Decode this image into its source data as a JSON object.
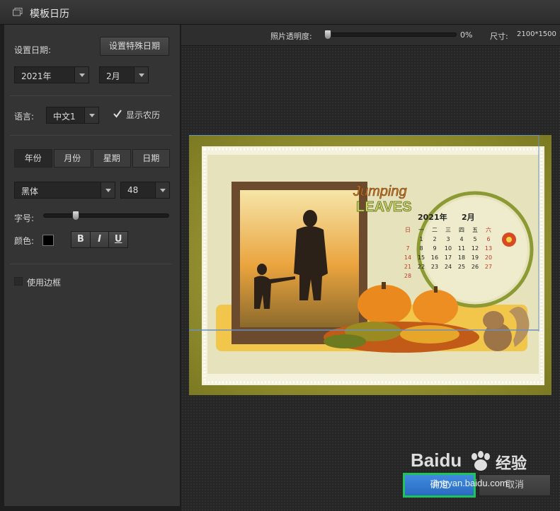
{
  "window": {
    "title": "模板日历"
  },
  "date": {
    "label": "设置日期:",
    "special_button": "设置特殊日期",
    "year": "2021年",
    "month": "2月"
  },
  "language": {
    "label": "语言:",
    "value": "中文1",
    "lunar_label": "显示农历",
    "lunar_checked": true
  },
  "tabs": [
    {
      "label": "年份",
      "active": true
    },
    {
      "label": "月份",
      "active": false
    },
    {
      "label": "星期",
      "active": false
    },
    {
      "label": "日期",
      "active": false
    }
  ],
  "font": {
    "family": "黑体",
    "size": "48",
    "size_label": "字号:",
    "color_label": "颜色:",
    "color": "#000000",
    "bold": "B",
    "italic": "I",
    "underline": "U"
  },
  "frame": {
    "label": "使用边框",
    "checked": false
  },
  "topbar": {
    "opacity_label": "照片透明度:",
    "opacity_value": "0%",
    "size_label": "尺寸:",
    "size_value": "2100*1500"
  },
  "preview": {
    "title_top": "Jumping",
    "title_bottom": "LEAVES",
    "cal_year": "2021年",
    "cal_month": "2月",
    "weekdays": [
      "日",
      "一",
      "二",
      "三",
      "四",
      "五",
      "六"
    ],
    "weeks": [
      [
        "",
        "1",
        "2",
        "3",
        "4",
        "5",
        "6"
      ],
      [
        "7",
        "8",
        "9",
        "10",
        "11",
        "12",
        "13"
      ],
      [
        "14",
        "15",
        "16",
        "17",
        "18",
        "19",
        "20"
      ],
      [
        "21",
        "22",
        "23",
        "24",
        "25",
        "26",
        "27"
      ],
      [
        "28",
        "",
        "",
        "",
        "",
        "",
        ""
      ]
    ]
  },
  "actions": {
    "ok": "确定",
    "cancel": "取消"
  },
  "watermark": {
    "brand": "Baidu",
    "product": "经验",
    "url": "jingyan.baidu.com"
  },
  "colors": {
    "accent": "#2a6bc0",
    "highlight": "#1ec45a",
    "panel": "#343434",
    "calendar_red": "#c0392b"
  }
}
